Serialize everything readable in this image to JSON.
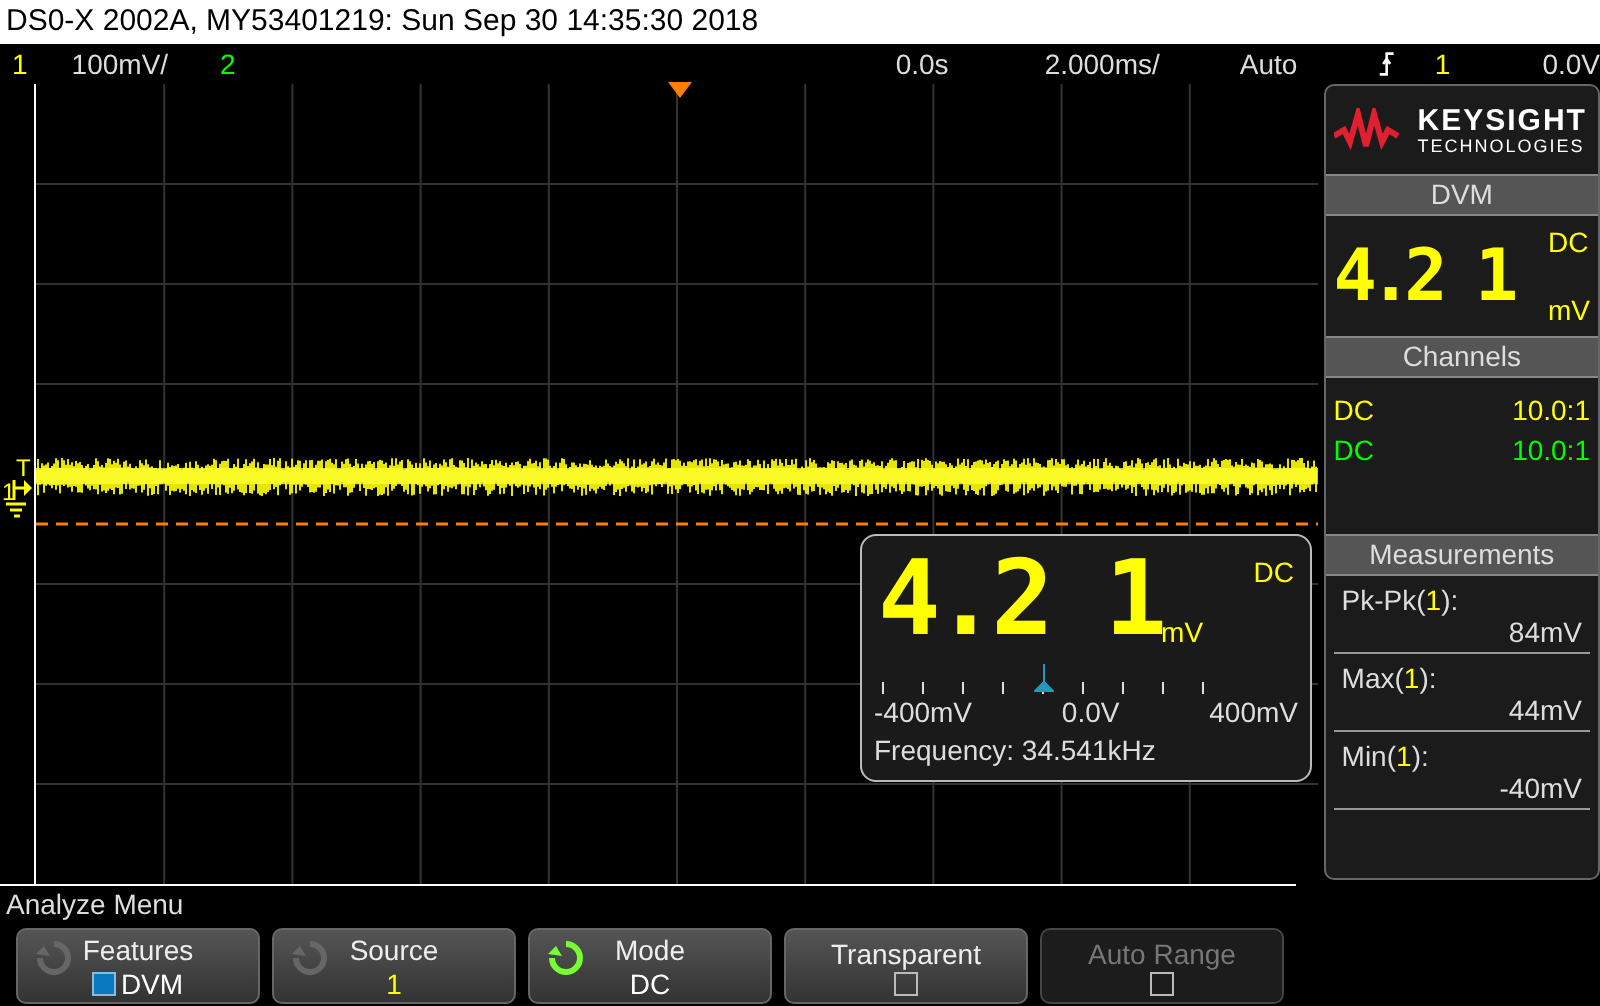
{
  "window": {
    "title": "DS0-X 2002A, MY53401219: Sun Sep 30 14:35:30 2018"
  },
  "status_bar": {
    "channel_1": "1",
    "scale": "100mV/",
    "channel_2": "2",
    "delay": "0.0s",
    "timebase": "2.000ms/",
    "trigger_mode": "Auto",
    "trigger_source": "1",
    "trigger_level": "0.0V"
  },
  "graticule": {
    "trigger_marker": "T",
    "ground_marker": "1"
  },
  "dvm_overlay": {
    "reading": "4.2 1",
    "unit": "mV",
    "coupling": "DC",
    "level": 0.5,
    "scale_labels": [
      "-400mV",
      "0.0V",
      "400mV"
    ],
    "frequency": "Frequency: 34.541kHz"
  },
  "panel": {
    "brand": {
      "name": "KEYSIGHT",
      "tagline": "TECHNOLOGIES"
    },
    "dvm": {
      "title": "DVM",
      "reading": "4.2 1",
      "coupling": "DC",
      "unit": "mV"
    },
    "channels": {
      "title": "Channels",
      "rows": [
        {
          "coupling": "DC",
          "probe": "10.0:1",
          "color": "#ffff00"
        },
        {
          "coupling": "DC",
          "probe": "10.0:1",
          "color": "#00ff00"
        }
      ]
    },
    "measurements": {
      "title": "Measurements",
      "items": [
        {
          "name": "Pk-Pk(",
          "source": "1",
          "suffix": "):",
          "value": "84mV"
        },
        {
          "name": "Max(",
          "source": "1",
          "suffix": "):",
          "value": "44mV"
        },
        {
          "name": "Min(",
          "source": "1",
          "suffix": "):",
          "value": "-40mV"
        }
      ]
    }
  },
  "menu": {
    "title": "Analyze Menu",
    "softkeys": [
      {
        "kind": "select",
        "label": "Features",
        "value": "DVM",
        "color": "#ffffff",
        "checked": true,
        "active": false,
        "disabled": false
      },
      {
        "kind": "select",
        "label": "Source",
        "value": "1",
        "color": "#ffff00",
        "active": false,
        "disabled": false
      },
      {
        "kind": "select",
        "label": "Mode",
        "value": "DC",
        "color": "#ffffff",
        "active": true,
        "disabled": false
      },
      {
        "kind": "toggle",
        "label": "Transparent",
        "checked": false,
        "disabled": false
      },
      {
        "kind": "toggle",
        "label": "Auto Range",
        "checked": false,
        "disabled": true
      }
    ]
  }
}
